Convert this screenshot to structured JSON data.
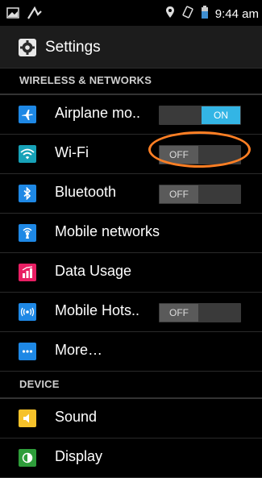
{
  "status": {
    "time": "9:44 am",
    "icons": [
      "image-icon",
      "signal-icon",
      "location-icon",
      "rotate-icon",
      "battery-icon"
    ]
  },
  "header": {
    "title": "Settings",
    "icon": "gear-icon"
  },
  "sections": {
    "wireless": "WIRELESS & NETWORKS",
    "device": "DEVICE"
  },
  "items": {
    "airplane": {
      "label": "Airplane mo..",
      "toggle": "ON",
      "icon": "airplane-icon",
      "color": "#1e88e5"
    },
    "wifi": {
      "label": "Wi-Fi",
      "toggle": "OFF",
      "icon": "wifi-icon",
      "color": "#17a2b8"
    },
    "bluetooth": {
      "label": "Bluetooth",
      "toggle": "OFF",
      "icon": "bluetooth-icon",
      "color": "#1e88e5"
    },
    "mobile_networks": {
      "label": "Mobile networks",
      "icon": "mobile-networks-icon",
      "color": "#1e88e5"
    },
    "data_usage": {
      "label": "Data Usage",
      "icon": "data-usage-icon",
      "color": "#e91e63"
    },
    "hotspot": {
      "label": "Mobile Hots..",
      "toggle": "OFF",
      "icon": "hotspot-icon",
      "color": "#1e88e5"
    },
    "more": {
      "label": "More…",
      "icon": "more-icon",
      "color": "#1e88e5"
    },
    "sound": {
      "label": "Sound",
      "icon": "sound-icon",
      "color": "#f6c22a"
    },
    "display": {
      "label": "Display",
      "icon": "display-icon",
      "color": "#2e9d3a"
    }
  },
  "colors": {
    "accent": "#33b5e5",
    "highlight": "#ff7f24"
  }
}
